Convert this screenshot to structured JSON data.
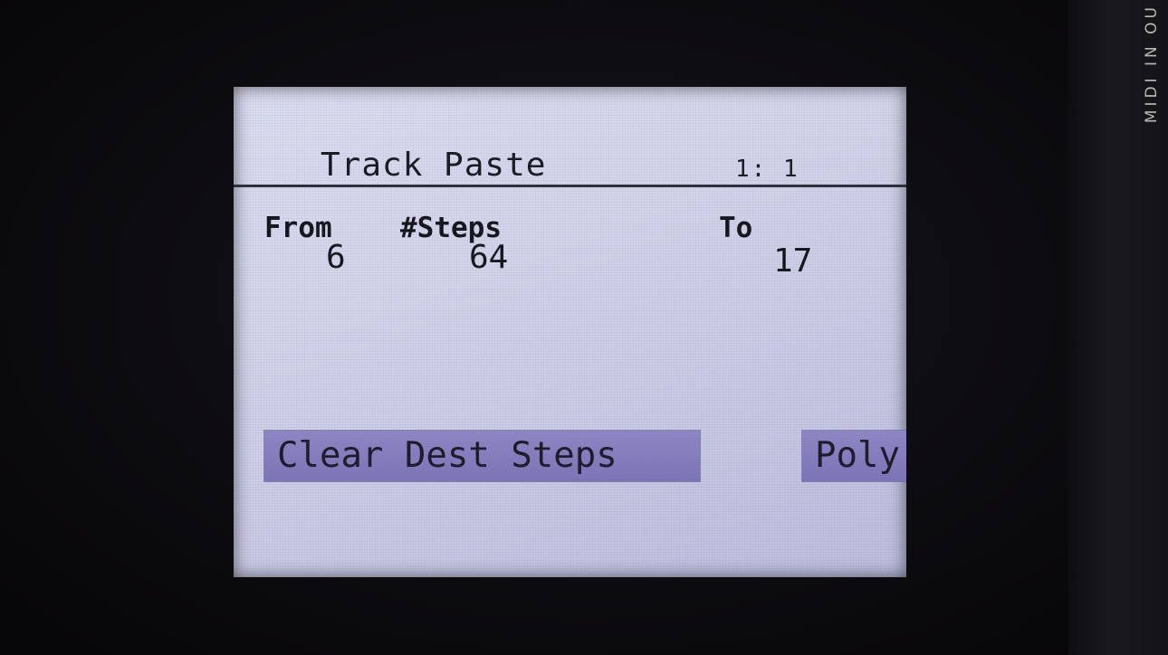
{
  "device": {
    "side_label": "MIDI IN OU"
  },
  "screen": {
    "title": "Track Paste",
    "position": "1: 1",
    "params": {
      "from": {
        "label": "From",
        "value": "6"
      },
      "steps": {
        "label": "#Steps",
        "value": "64"
      },
      "to": {
        "label": "To",
        "value": "17"
      }
    },
    "buttons": {
      "clear_dest_steps": "Clear Dest Steps",
      "poly": "Poly"
    }
  },
  "colors": {
    "screen_bg": "#d4d6ec",
    "button_bg": "#857dbf",
    "text": "#111118"
  }
}
